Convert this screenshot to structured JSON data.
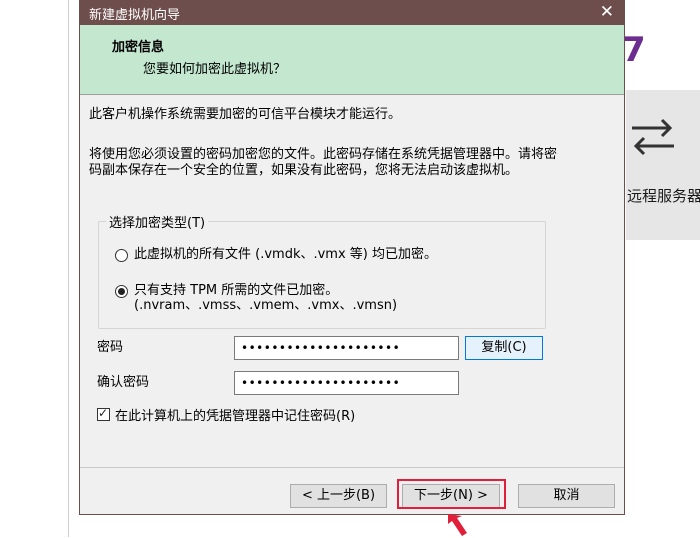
{
  "background": {
    "remote_label": "远程服务器",
    "purple_glyph": "7"
  },
  "dialog": {
    "title": "新建虚拟机向导",
    "close_icon": "close-icon",
    "header": {
      "title": "加密信息",
      "subtitle": "您要如何加密此虚拟机？"
    },
    "intro_text": "此客户机操作系统需要加密的可信平台模块才能运行。",
    "description": "将使用您必须设置的密码加密您的文件。此密码存储在系统凭据管理器中。请将密码副本保存在一个安全的位置，如果没有此密码，您将无法启动该虚拟机。",
    "encryption_group": {
      "legend": "选择加密类型(T)",
      "options": [
        {
          "label": "此虚拟机的所有文件 (.vmdk、.vmx 等) 均已加密。",
          "selected": false
        },
        {
          "label": "只有支持 TPM 所需的文件已加密。(.nvram、.vmss、.vmem、.vmx、.vmsn)",
          "selected": true
        }
      ]
    },
    "password": {
      "label": "密码",
      "value": "•••••••••••••••••••••",
      "copy_button": "复制(C)"
    },
    "confirm_password": {
      "label": "确认密码",
      "value": "•••••••••••••••••••••"
    },
    "remember_checkbox": {
      "label": "在此计算机上的凭据管理器中记住密码(R)",
      "checked": true
    },
    "buttons": {
      "back": "< 上一步(B)",
      "next": "下一步(N) >",
      "cancel": "取消"
    }
  },
  "colors": {
    "titlebar": "#6e4d4d",
    "header_band": "#c4e7d0",
    "highlight": "#e0203a"
  }
}
